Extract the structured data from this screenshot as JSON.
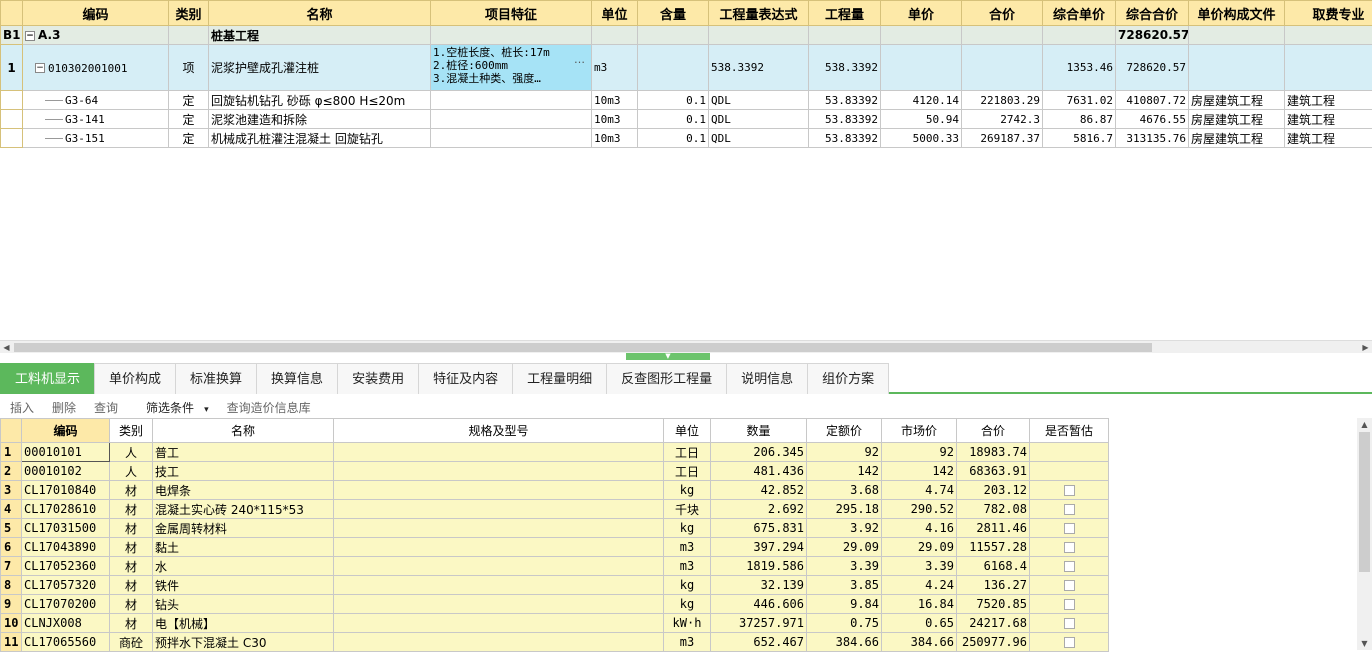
{
  "upper": {
    "columns": [
      "编码",
      "类别",
      "名称",
      "项目特征",
      "单位",
      "含量",
      "工程量表达式",
      "工程量",
      "单价",
      "合价",
      "综合单价",
      "综合合价",
      "单价构成文件",
      "取费专业"
    ],
    "group": {
      "row_label": "B1",
      "expander": "−",
      "code": "A.3",
      "name": "桩基工程",
      "total": "728620.57"
    },
    "item": {
      "row_label": "1",
      "expander": "−",
      "code": "010302001001",
      "type": "项",
      "name": "泥浆护壁成孔灌注桩",
      "features": [
        "1.空桩长度、桩长:17m",
        "2.桩径:600mm",
        "3.混凝土种类、强度…"
      ],
      "feature_btn": "…",
      "unit": "m3",
      "content": "",
      "expr": "538.3392",
      "qty": "538.3392",
      "price": "",
      "amount": "",
      "unit_total": "1353.46",
      "total": "728620.57",
      "file": "",
      "spec": ""
    },
    "subs": [
      {
        "code": "G3-64",
        "type": "定",
        "name": "回旋钻机钻孔 砂砾 φ≤800 H≤20m",
        "features": "",
        "unit": "10m3",
        "content": "0.1",
        "expr": "QDL",
        "qty": "53.83392",
        "price": "4120.14",
        "amount": "221803.29",
        "unit_total": "7631.02",
        "total": "410807.72",
        "file": "房屋建筑工程",
        "spec": "建筑工程"
      },
      {
        "code": "G3-141",
        "type": "定",
        "name": "泥浆池建造和拆除",
        "features": "",
        "unit": "10m3",
        "content": "0.1",
        "expr": "QDL",
        "qty": "53.83392",
        "price": "50.94",
        "amount": "2742.3",
        "unit_total": "86.87",
        "total": "4676.55",
        "file": "房屋建筑工程",
        "spec": "建筑工程"
      },
      {
        "code": "G3-151",
        "type": "定",
        "name": "机械成孔桩灌注混凝土 回旋钻孔",
        "features": "",
        "unit": "10m3",
        "content": "0.1",
        "expr": "QDL",
        "qty": "53.83392",
        "price": "5000.33",
        "amount": "269187.37",
        "unit_total": "5816.7",
        "total": "313135.76",
        "file": "房屋建筑工程",
        "spec": "建筑工程"
      }
    ]
  },
  "tabs": [
    "工料机显示",
    "单价构成",
    "标准换算",
    "换算信息",
    "安装费用",
    "特征及内容",
    "工程量明细",
    "反查图形工程量",
    "说明信息",
    "组价方案"
  ],
  "toolbar": {
    "insert": "插入",
    "delete": "删除",
    "query": "查询",
    "filter": "筛选条件",
    "filter_arrow": "▾",
    "price_db": "查询造价信息库"
  },
  "lower": {
    "columns": [
      "编码",
      "类别",
      "名称",
      "规格及型号",
      "单位",
      "数量",
      "定额价",
      "市场价",
      "合价",
      "是否暂估"
    ],
    "rows": [
      {
        "n": "1",
        "code": "00010101",
        "type": "人",
        "name": "普工",
        "model": "",
        "unit": "工日",
        "qty": "206.345",
        "quota": "92",
        "market": "92",
        "amount": "18983.74",
        "chk": false
      },
      {
        "n": "2",
        "code": "00010102",
        "type": "人",
        "name": "技工",
        "model": "",
        "unit": "工日",
        "qty": "481.436",
        "quota": "142",
        "market": "142",
        "amount": "68363.91",
        "chk": false
      },
      {
        "n": "3",
        "code": "CL17010840",
        "type": "材",
        "name": "电焊条",
        "model": "",
        "unit": "kg",
        "qty": "42.852",
        "quota": "3.68",
        "market": "4.74",
        "amount": "203.12",
        "chk": true
      },
      {
        "n": "4",
        "code": "CL17028610",
        "type": "材",
        "name": "混凝土实心砖 240*115*53",
        "model": "",
        "unit": "千块",
        "qty": "2.692",
        "quota": "295.18",
        "market": "290.52",
        "amount": "782.08",
        "chk": true
      },
      {
        "n": "5",
        "code": "CL17031500",
        "type": "材",
        "name": "金属周转材料",
        "model": "",
        "unit": "kg",
        "qty": "675.831",
        "quota": "3.92",
        "market": "4.16",
        "amount": "2811.46",
        "chk": true
      },
      {
        "n": "6",
        "code": "CL17043890",
        "type": "材",
        "name": "黏土",
        "model": "",
        "unit": "m3",
        "qty": "397.294",
        "quota": "29.09",
        "market": "29.09",
        "amount": "11557.28",
        "chk": true
      },
      {
        "n": "7",
        "code": "CL17052360",
        "type": "材",
        "name": "水",
        "model": "",
        "unit": "m3",
        "qty": "1819.586",
        "quota": "3.39",
        "market": "3.39",
        "amount": "6168.4",
        "chk": true
      },
      {
        "n": "8",
        "code": "CL17057320",
        "type": "材",
        "name": "铁件",
        "model": "",
        "unit": "kg",
        "qty": "32.139",
        "quota": "3.85",
        "market": "4.24",
        "amount": "136.27",
        "chk": true
      },
      {
        "n": "9",
        "code": "CL17070200",
        "type": "材",
        "name": "钻头",
        "model": "",
        "unit": "kg",
        "qty": "446.606",
        "quota": "9.84",
        "market": "16.84",
        "amount": "7520.85",
        "chk": true
      },
      {
        "n": "10",
        "code": "CLNJX008",
        "type": "材",
        "name": "电【机械】",
        "model": "",
        "unit": "kW·h",
        "qty": "37257.971",
        "quota": "0.75",
        "market": "0.65",
        "amount": "24217.68",
        "chk": true
      },
      {
        "n": "11",
        "code": "CL17065560",
        "type": "商砼",
        "name": "预拌水下混凝土 C30",
        "model": "",
        "unit": "m3",
        "qty": "652.467",
        "quota": "384.66",
        "market": "384.66",
        "amount": "250977.96",
        "chk": true
      }
    ]
  }
}
